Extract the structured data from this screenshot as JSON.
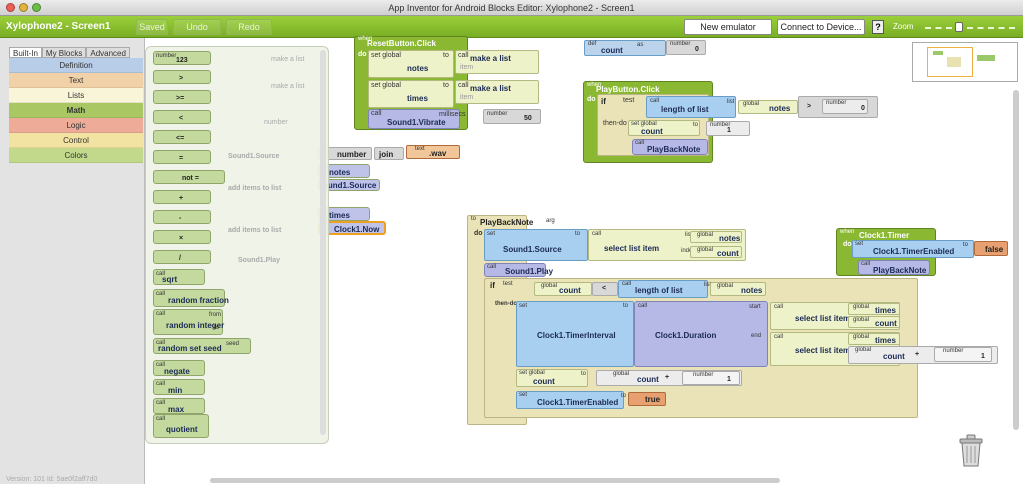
{
  "window": {
    "title": "App Inventor for Android Blocks Editor: Xylophone2 - Screen1"
  },
  "toolbar": {
    "app_name": "Xylophone2 - Screen1",
    "saved": "Saved",
    "undo": "Undo",
    "redo": "Redo",
    "new_emulator": "New emulator",
    "connect": "Connect to Device...",
    "help": "?",
    "zoom": "Zoom"
  },
  "tabs": {
    "builtin": "Built-In",
    "myblocks": "My Blocks",
    "advanced": "Advanced"
  },
  "categories": [
    {
      "label": "Definition",
      "color": "#b7cde8"
    },
    {
      "label": "Text",
      "color": "#f1d1a8"
    },
    {
      "label": "Lists",
      "color": "#f8f5d8"
    },
    {
      "label": "Math",
      "color": "#a9c864"
    },
    {
      "label": "Logic",
      "color": "#eeab97"
    },
    {
      "label": "Control",
      "color": "#f3e3a2"
    },
    {
      "label": "Colors",
      "color": "#c2d98c"
    }
  ],
  "version": "Version: 101 Id: 5ae0f2aff7d0",
  "drawer": {
    "number_label": "number",
    "number_value": "123",
    "ops": [
      ">",
      ">=",
      "<",
      "<=",
      "=",
      "not =",
      "+",
      "-",
      "×",
      "/"
    ],
    "call": "call",
    "funcs": [
      "sqrt",
      "random fraction",
      "random integer",
      "random set seed",
      "negate",
      "min",
      "max",
      "quotient"
    ],
    "from": "from",
    "to": "to",
    "seed": "seed"
  },
  "ghost": {
    "make_a_list": "make a list",
    "item": "item",
    "number": "number",
    "sound_source": "Sound1.Source",
    "add_items": "add items to list",
    "list": "list",
    "sound_play": "Sound1.Play"
  },
  "peek": {
    "number": "number",
    "join": "join",
    "text": "text",
    "wav": ".wav",
    "notes": "notes",
    "sound_source": "ound1.Source",
    "times": "times",
    "clock_now": "Clock1.Now"
  },
  "reset": {
    "when": "when",
    "event": "ResetButton.Click",
    "do": "do",
    "set_global": "set global",
    "to": "to",
    "notes": "notes",
    "times": "times",
    "call": "call",
    "make_a_list": "make a list",
    "item": "item",
    "vibrate": "Sound1.Vibrate",
    "ms": "millisecs",
    "number": "number",
    "ms_value": "50"
  },
  "defcount": {
    "def": "def",
    "count": "count",
    "as": "as",
    "number": "number",
    "value": "0"
  },
  "play": {
    "when": "when",
    "event": "PlayButton.Click",
    "do": "do",
    "if": "if",
    "test": "test",
    "call": "call",
    "length": "length of list",
    "list": "list",
    "global": "global",
    "notes": "notes",
    "gt": ">",
    "number": "number",
    "zero": "0",
    "then_do": "then-do",
    "set_global": "set global",
    "count": "count",
    "to": "to",
    "one": "1",
    "playback": "PlayBackNote"
  },
  "proc": {
    "to": "to",
    "name": "PlayBackNote",
    "arg": "arg",
    "do": "do",
    "set": "set",
    "sound_source": "Sound1.Source",
    "call": "call",
    "select": "select list item",
    "list": "list",
    "index": "index",
    "global": "global",
    "notes": "notes",
    "count": "count",
    "sound_play": "Sound1.Play",
    "if": "if",
    "test": "test",
    "lt": "<",
    "length": "length of list",
    "then_do": "then-do",
    "timer_interval": "Clock1.TimerInterval",
    "duration": "Clock1.Duration",
    "start": "start",
    "end": "end",
    "times": "times",
    "plus": "+",
    "number": "number",
    "one": "1",
    "set_global": "set global",
    "timer_enabled": "Clock1.TimerEnabled",
    "true_val": "true"
  },
  "timer": {
    "when": "when",
    "event": "Clock1.Timer",
    "do": "do",
    "set": "set",
    "timer_enabled": "Clock1.TimerEnabled",
    "to": "to",
    "false_val": "false",
    "call": "call",
    "playback": "PlayBackNote"
  }
}
